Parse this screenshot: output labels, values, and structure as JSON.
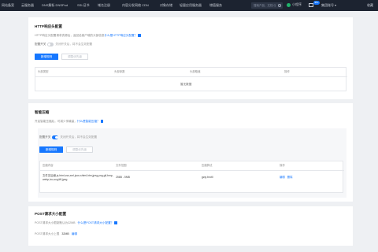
{
  "nav": {
    "tabs": [
      "网站备案",
      "云服务器",
      "DNS解析 DNSPod",
      "SSL证书",
      "域名注册",
      "内容分发网络 CDN",
      "对象存储",
      "轻量应用服务器",
      "增值服务"
    ],
    "search_placeholder": "搜索产品、文档 Q",
    "mini_program": "小程序",
    "mail_badge": "99+",
    "user": "集团账号",
    "favorites": "收藏"
  },
  "http_card": {
    "title": "HTTP响应头配置",
    "desc": "HTTP响应头配置请求资源后，返回给客户端的头部信息",
    "link": "什么是HTTP响应头配置？",
    "toggle_label": "配置开关",
    "toggle_hint": "关闭开关后，将不会生效配置",
    "add_button": "新增规则",
    "disabled_button": "调整优先级",
    "columns": [
      "头部类型",
      "头部参数",
      "头部取值",
      "操作"
    ],
    "empty_text": "暂无数据"
  },
  "compress_card": {
    "title": "智能压缩",
    "desc": "开启智能压缩后，可减少传输量，",
    "link": "什么是智能压缩？",
    "toggle_label": "配置开关",
    "toggle_hint": "关闭开关后，将不会生效配置",
    "add_button": "新增规则",
    "disabled_button": "调整优先级",
    "columns": [
      "压缩内容",
      "文件范围",
      "压缩算法",
      "操作"
    ],
    "rows": [
      {
        "content_line1": "文件名后缀,js,html,css,xml,json,shtml,htm,jpeg,png,gif,bmp,",
        "content_line2": "webp,ico,svg,tiff,jpeg",
        "range": "256B - 5MB",
        "algo": "gzip,brotli",
        "edit": "编辑",
        "delete": "删除"
      }
    ]
  },
  "post_card": {
    "title": "POST请求大小配置",
    "desc": "POST请求大小限制默认为32MB",
    "link": "什么是POST请求大小配置？",
    "kv_label": "POST请求大小上限",
    "kv_value": "32MB",
    "kv_edit": "编辑"
  },
  "colors": {
    "accent": "#1677ff",
    "topbar": "#1c2330",
    "page_bg": "#eef0f3"
  },
  "icons": [
    "search-icon",
    "mail-icon",
    "info-icon",
    "mini-program-icon"
  ]
}
